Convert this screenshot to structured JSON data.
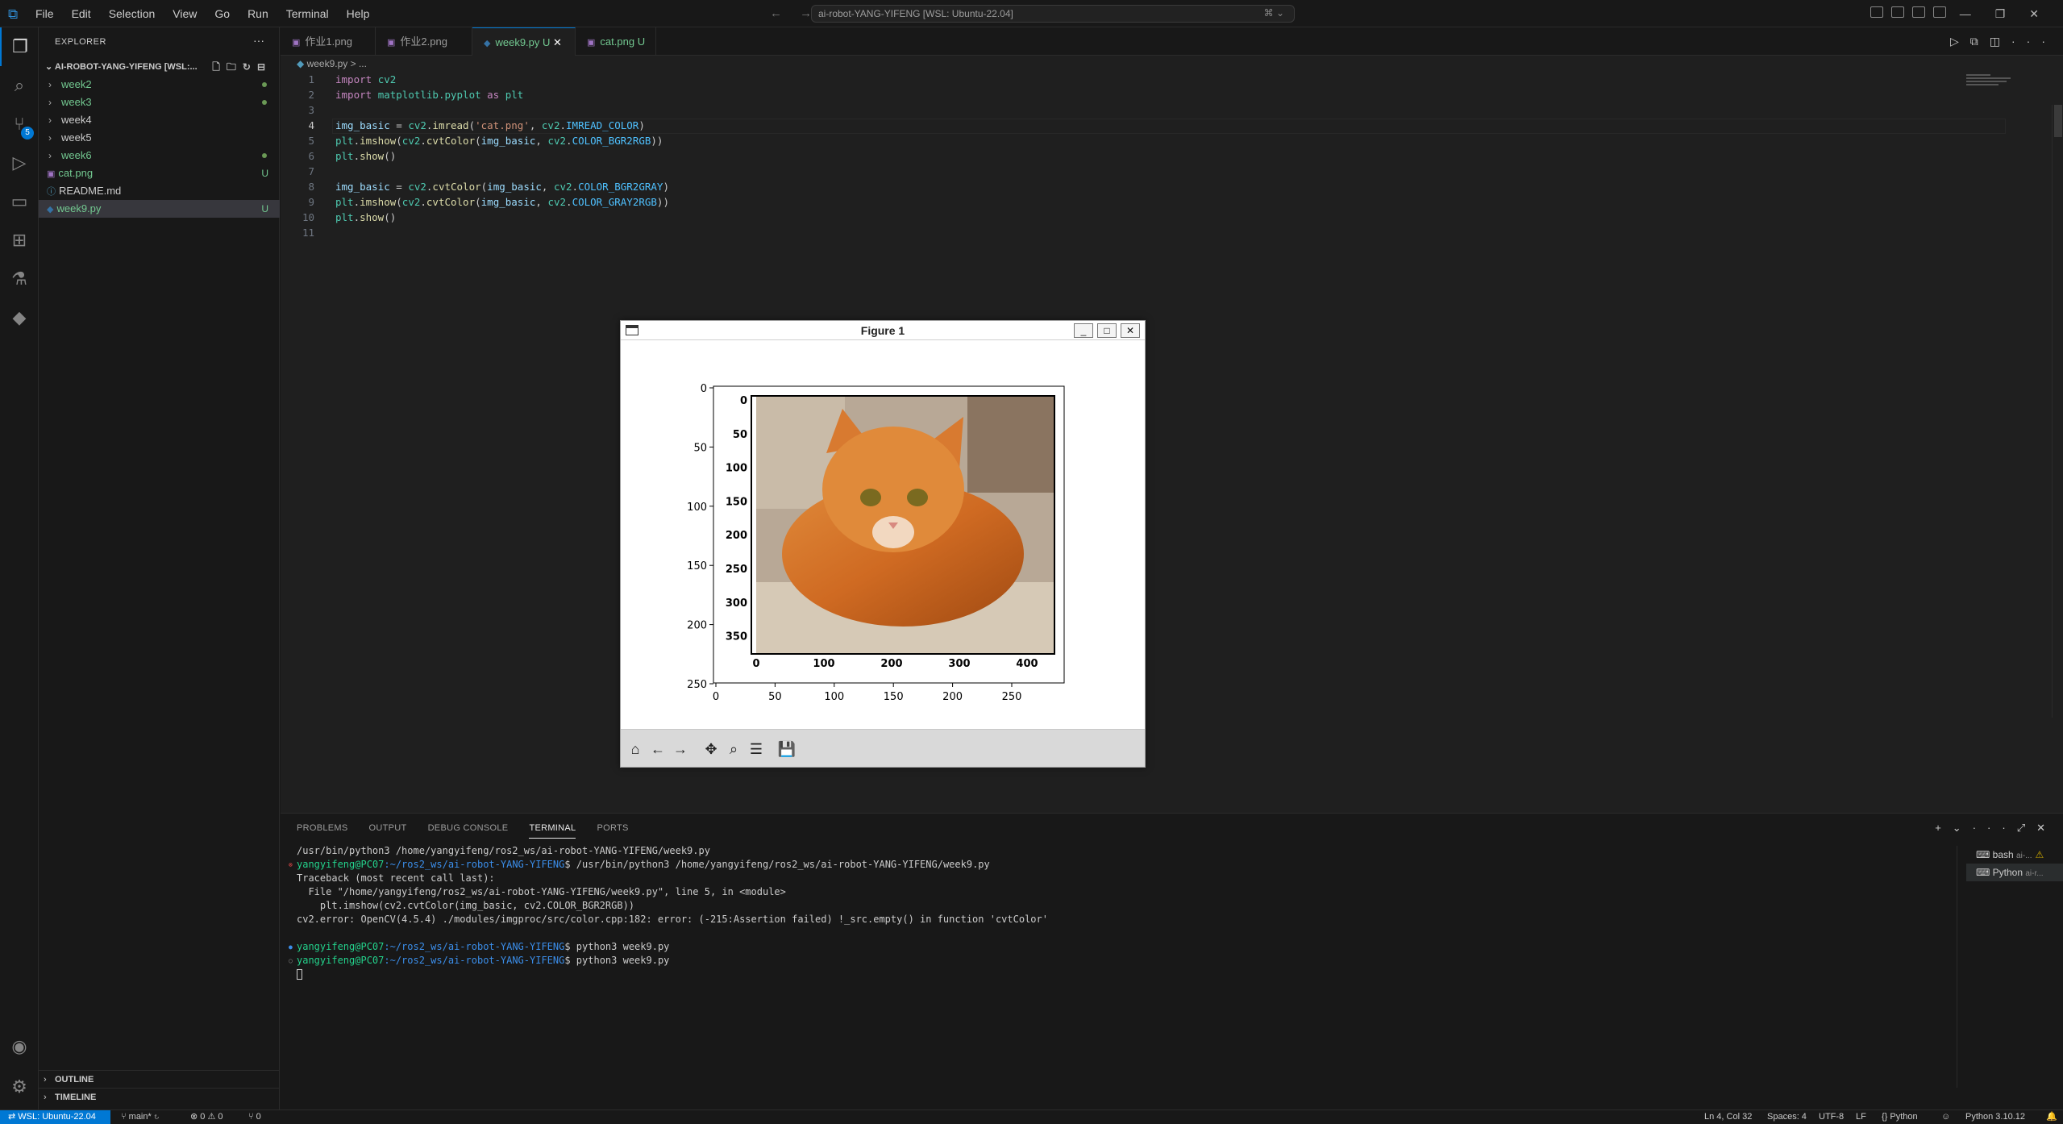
{
  "titlebar": {
    "menus": [
      "File",
      "Edit",
      "Selection",
      "View",
      "Go",
      "Run",
      "Terminal",
      "Help"
    ],
    "command_center": "ai-robot-YANG-YIFENG [WSL: Ubuntu-22.04]"
  },
  "activity": {
    "scm_badge": "5"
  },
  "sidebar": {
    "title": "EXPLORER",
    "project": "AI-ROBOT-YANG-YIFENG [WSL:...",
    "items": [
      {
        "label": "week2",
        "type": "folder",
        "status": "dot"
      },
      {
        "label": "week3",
        "type": "folder",
        "status": "dot"
      },
      {
        "label": "week4",
        "type": "folder",
        "status": ""
      },
      {
        "label": "week5",
        "type": "folder",
        "status": ""
      },
      {
        "label": "week6",
        "type": "folder",
        "status": "dot"
      },
      {
        "label": "cat.png",
        "type": "image",
        "status": "U"
      },
      {
        "label": "README.md",
        "type": "info",
        "status": ""
      },
      {
        "label": "week9.py",
        "type": "python",
        "status": "U"
      }
    ],
    "outline": "OUTLINE",
    "timeline": "TIMELINE"
  },
  "tabs": [
    {
      "label": "作业1.png",
      "modified": ""
    },
    {
      "label": "作业2.png",
      "modified": ""
    },
    {
      "label": "week9.py",
      "modified": "U"
    },
    {
      "label": "cat.png",
      "modified": "U"
    }
  ],
  "breadcrumb": {
    "file": "week9.py",
    "rest": "> ..."
  },
  "code": {
    "line_numbers": [
      "1",
      "2",
      "3",
      "4",
      "5",
      "6",
      "7",
      "8",
      "9",
      "10",
      "11"
    ],
    "cursor_line": "4"
  },
  "figure": {
    "title": "Figure 1",
    "outer_axis": {
      "x_ticks": [
        "0",
        "50",
        "100",
        "150",
        "200",
        "250"
      ],
      "y_ticks": [
        "0",
        "50",
        "100",
        "150",
        "200",
        "250"
      ]
    },
    "inner_axis": {
      "x_ticks": [
        "0",
        "100",
        "200",
        "300",
        "400"
      ],
      "y_ticks": [
        "0",
        "50",
        "100",
        "150",
        "200",
        "250",
        "300",
        "350"
      ]
    }
  },
  "panel": {
    "tabs": [
      "PROBLEMS",
      "OUTPUT",
      "DEBUG CONSOLE",
      "TERMINAL",
      "PORTS"
    ],
    "terminal_lines": [
      {
        "pre": "",
        "user": "",
        "path": "",
        "text": "/usr/bin/python3 /home/yangyifeng/ros2_ws/ai-robot-YANG-YIFENG/week9.py"
      },
      {
        "pre": "",
        "user": "yangyifeng@PC07",
        "path": ":~/ros2_ws/ai-robot-YANG-YIFENG",
        "text": "$ /usr/bin/python3 /home/yangyifeng/ros2_ws/ai-robot-YANG-YIFENG/week9.py"
      },
      {
        "pre": "",
        "user": "",
        "path": "",
        "text": "Traceback (most recent call last):"
      },
      {
        "pre": "",
        "user": "",
        "path": "",
        "text": "  File \"/home/yangyifeng/ros2_ws/ai-robot-YANG-YIFENG/week9.py\", line 5, in <module>"
      },
      {
        "pre": "",
        "user": "",
        "path": "",
        "text": "    plt.imshow(cv2.cvtColor(img_basic, cv2.COLOR_BGR2RGB))"
      },
      {
        "pre": "",
        "user": "",
        "path": "",
        "text": "cv2.error: OpenCV(4.5.4) ./modules/imgproc/src/color.cpp:182: error: (-215:Assertion failed) !_src.empty() in function 'cvtColor'"
      },
      {
        "pre": "",
        "user": "",
        "path": "",
        "text": ""
      },
      {
        "pre": "",
        "user": "yangyifeng@PC07",
        "path": ":~/ros2_ws/ai-robot-YANG-YIFENG",
        "text": "$ python3 week9.py"
      },
      {
        "pre": "",
        "user": "yangyifeng@PC07",
        "path": ":~/ros2_ws/ai-robot-YANG-YIFENG",
        "text": "$ python3 week9.py"
      }
    ],
    "terminals": [
      {
        "label": "bash",
        "sub": "ai-..."
      },
      {
        "label": "Python",
        "sub": "ai-r..."
      }
    ]
  },
  "statusbar": {
    "remote": "WSL: Ubuntu-22.04",
    "branch": "main*",
    "problems": "0 ⚠ 0",
    "ports": "0",
    "position": "Ln 4, Col 32",
    "spaces": "Spaces: 4",
    "encoding": "UTF-8",
    "eol": "LF",
    "language": "Python",
    "interpreter": "Python 3.10.12"
  },
  "colors": {
    "accent": "#0078d4",
    "sidebar_selection": "#37373d",
    "terminal_user": "#23d18b",
    "terminal_path": "#3b8eea"
  }
}
